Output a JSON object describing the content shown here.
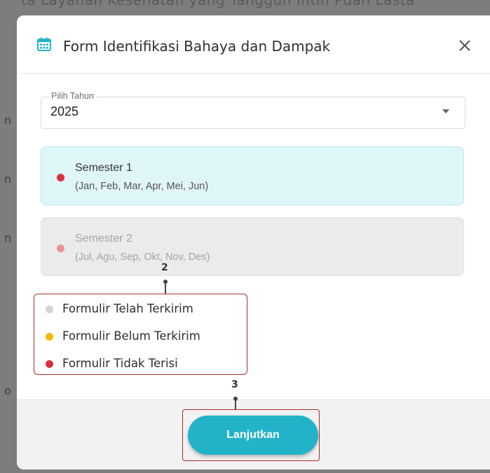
{
  "background": {
    "top_text": "ta Layanan Kesehatan yang Tanggun Intin Pdan Lasta",
    "side_chars": [
      "n",
      "n",
      "n",
      "o"
    ]
  },
  "modal": {
    "title": "Form Identifikasi Bahaya dan Dampak",
    "icon": "calendar-icon",
    "close_icon": "close-icon"
  },
  "year_select": {
    "label": "Pilih Tahun",
    "value": "2025"
  },
  "semesters": [
    {
      "title": "Semester 1",
      "months": "(Jan, Feb, Mar, Apr, Mei, Jun)",
      "state": "active",
      "dot_color": "#d9323f"
    },
    {
      "title": "Semester 2",
      "months": "(Jul, Agu, Sep, Okt, Nov, Des)",
      "state": "disabled",
      "dot_color": "#ee8f97"
    }
  ],
  "legend": [
    {
      "label": "Formulir Telah Terkirim",
      "color": "#d3d3d3"
    },
    {
      "label": "Formulir Belum Terkirim",
      "color": "#f3b800"
    },
    {
      "label": "Formulir Tidak Terisi",
      "color": "#d9323f"
    }
  ],
  "callouts": {
    "legend": "2",
    "button": "3"
  },
  "footer": {
    "button_label": "Lanjutkan"
  },
  "colors": {
    "accent": "#22b3c9",
    "callout_border": "#b32a2a",
    "active_card": "#dff6f9"
  }
}
